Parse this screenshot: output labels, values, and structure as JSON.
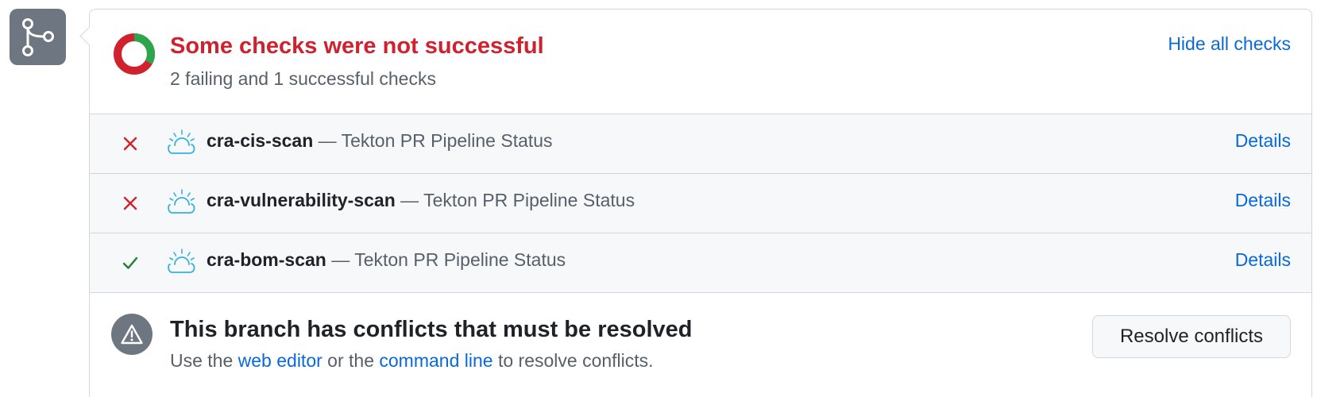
{
  "branch_badge": {
    "icon": "git-branch-icon",
    "bg_color": "#6e7781"
  },
  "checks": {
    "title": "Some checks were not successful",
    "subtitle": "2 failing and 1 successful checks",
    "toggle_label": "Hide all checks",
    "donut": {
      "failing": 2,
      "successful": 1,
      "fail_color": "#cf222e",
      "success_color": "#2da44e"
    },
    "items": [
      {
        "status": "failure",
        "status_icon": "x-icon",
        "app_icon": "tekton-cloud-icon",
        "name": "cra-cis-scan",
        "separator": " — ",
        "description": "Tekton PR Pipeline Status",
        "link_label": "Details"
      },
      {
        "status": "failure",
        "status_icon": "x-icon",
        "app_icon": "tekton-cloud-icon",
        "name": "cra-vulnerability-scan",
        "separator": " — ",
        "description": "Tekton PR Pipeline Status",
        "link_label": "Details"
      },
      {
        "status": "success",
        "status_icon": "check-icon",
        "app_icon": "tekton-cloud-icon",
        "name": "cra-bom-scan",
        "separator": " — ",
        "description": "Tekton PR Pipeline Status",
        "link_label": "Details"
      }
    ]
  },
  "conflicts": {
    "icon": "alert-icon",
    "title": "This branch has conflicts that must be resolved",
    "desc_prefix": "Use the ",
    "web_editor_label": "web editor",
    "desc_middle": " or the ",
    "command_line_label": "command line",
    "desc_suffix": " to resolve conflicts.",
    "button_label": "Resolve conflicts"
  }
}
